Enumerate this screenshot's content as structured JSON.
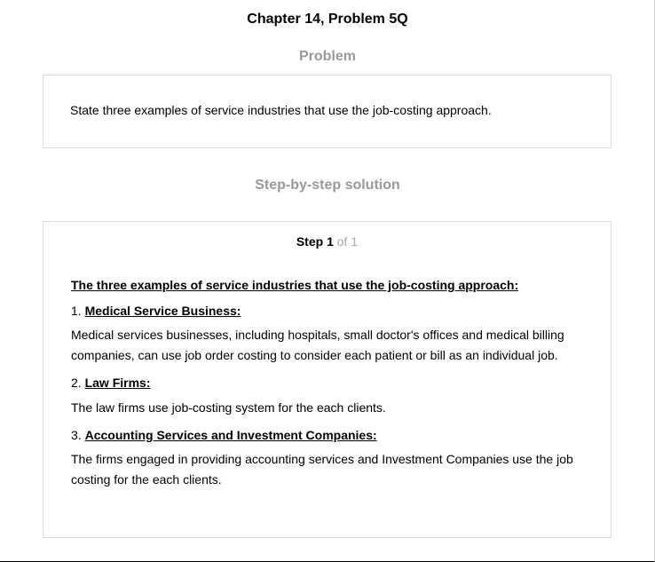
{
  "header": {
    "chapter_title": "Chapter 14, Problem 5Q"
  },
  "problem": {
    "heading": "Problem",
    "text": "State three examples of service industries that use the job-costing approach."
  },
  "solution": {
    "heading": "Step-by-step solution",
    "step": {
      "word": "Step",
      "number": "1",
      "of_word": "of",
      "total": "1"
    },
    "intro_heading": "The three examples of service industries that use the job-costing approach:",
    "items": [
      {
        "number": "1.",
        "title": "Medical Service Business:",
        "text": "Medical services businesses, including hospitals, small doctor's offices and medical billing companies, can use job order costing to consider each patient or bill as an individual job."
      },
      {
        "number": "2.",
        "title": "Law Firms:",
        "text": "The law firms use job-costing system for the each clients."
      },
      {
        "number": "3.",
        "title": "Accounting Services and Investment Companies:",
        "text": "The firms engaged in providing accounting services and Investment Companies use the job costing for the each clients."
      }
    ]
  }
}
